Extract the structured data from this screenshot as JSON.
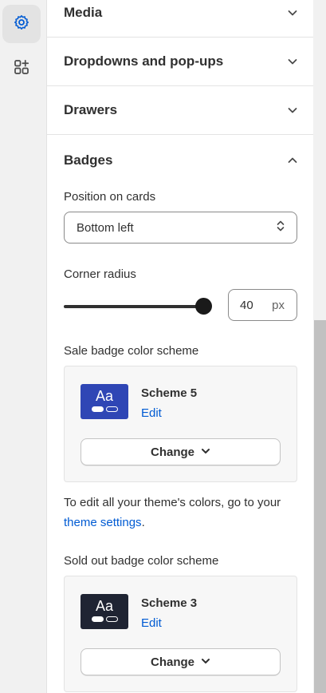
{
  "rail": {
    "items": [
      {
        "icon": "gear-icon",
        "active": true
      },
      {
        "icon": "add-section-icon",
        "active": false
      }
    ]
  },
  "sections": {
    "media": "Media",
    "dropdowns": "Dropdowns and pop-ups",
    "drawers": "Drawers",
    "badges": "Badges"
  },
  "badges": {
    "position_label": "Position on cards",
    "position_value": "Bottom left",
    "corner_radius_label": "Corner radius",
    "corner_radius_value": "40",
    "corner_radius_unit": "px",
    "corner_radius_slider_fraction": 1.0,
    "sale_label": "Sale badge color scheme",
    "sale_scheme": {
      "swatch_text": "Aa",
      "swatch_color": "#2f46b5",
      "name": "Scheme 5",
      "edit": "Edit",
      "change": "Change"
    },
    "help_prefix": "To edit all your theme's colors, go to your",
    "help_link": "theme settings",
    "help_suffix": ".",
    "soldout_label": "Sold out badge color scheme",
    "soldout_scheme": {
      "swatch_text": "Aa",
      "swatch_color": "#1f2433",
      "name": "Scheme 3",
      "edit": "Edit",
      "change": "Change"
    }
  },
  "colors": {
    "link": "#005bd3",
    "text": "#303030",
    "panel_bg": "#ffffff",
    "rail_bg": "#f1f1f1"
  }
}
